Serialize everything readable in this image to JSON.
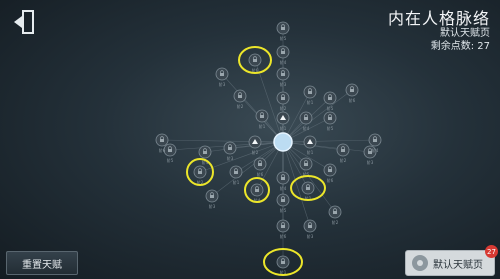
{
  "header": {
    "title": "内在人格脉络",
    "subtitle": "默认天赋页",
    "points_label": "剩余点数:",
    "points_value": "27"
  },
  "buttons": {
    "exit_icon": "exit-door-icon",
    "reset_label": "重置天赋",
    "default_page_label": "默认天赋页",
    "default_page_badge": "27"
  },
  "talent_tree": {
    "center_node": "persona-web-core",
    "node_state": "locked",
    "branch_labels": [
      "阶1",
      "阶2",
      "阶3",
      "阶4",
      "阶5",
      "阶6"
    ],
    "highlighted_nodes": 6,
    "colors": {
      "link": "#6e7c86",
      "node_fill": "#3b4750",
      "node_stroke": "#7c8a93",
      "core": "#bcdcf2",
      "highlight": "#ece62a",
      "unlocked_icon": "#f2f5f7"
    }
  }
}
